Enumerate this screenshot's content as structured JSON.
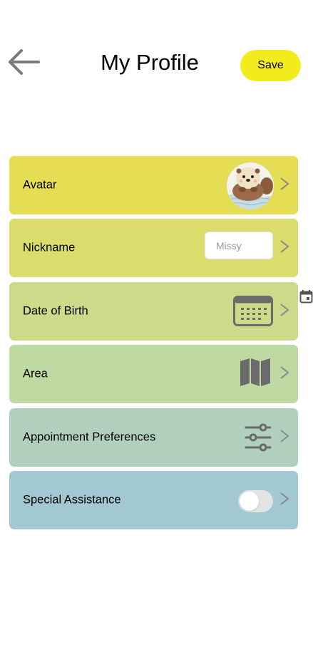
{
  "header": {
    "title": "My Profile",
    "save_label": "Save",
    "back_icon": "arrow-left-icon"
  },
  "colors": {
    "save_button": "#f2ec1f",
    "row_avatar": "#e5de55",
    "row_nickname": "#dadc6c",
    "row_dob": "#cdda8a",
    "row_area": "#bfd9a2",
    "row_preferences": "#b0cfbd",
    "row_assistance": "#a2c9d2",
    "icon_gray": "#6b6b6b",
    "chevron_gray": "#8a8a8a"
  },
  "rows": [
    {
      "label": "Avatar",
      "control": "avatar-image"
    },
    {
      "label": "Nickname",
      "control": "text-input",
      "placeholder": "Missy",
      "value": ""
    },
    {
      "label": "Date of Birth",
      "control": "calendar-icon"
    },
    {
      "label": "Area",
      "control": "map-icon"
    },
    {
      "label": "Appointment Preferences",
      "control": "sliders-icon"
    },
    {
      "label": "Special Assistance",
      "control": "toggle",
      "toggle_on": false
    }
  ],
  "chevron_icon": "chevron-right-icon",
  "date_picker_icon": "calendar-event-icon"
}
